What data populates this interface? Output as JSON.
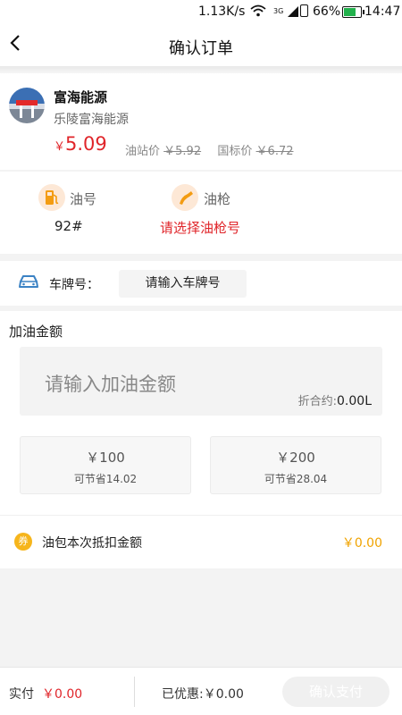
{
  "status_bar": {
    "speed": "1.13K/s",
    "network": "3G",
    "battery": "66%",
    "battery_level": 0.66,
    "time": "14:47"
  },
  "header": {
    "back_icon": "chevron-left-icon",
    "title": "确认订单"
  },
  "station": {
    "name": "富海能源",
    "subname": "乐陵富海能源",
    "price_currency": "￥",
    "price": "5.09",
    "station_price_label": "油站价",
    "station_price": "￥5.92",
    "national_price_label": "国标价",
    "national_price": "￥6.72"
  },
  "fuel": {
    "grade_label": "油号",
    "grade_value": "92#",
    "nozzle_label": "油枪",
    "nozzle_value": "请选择油枪号",
    "nozzle_color": "#e0252a"
  },
  "plate": {
    "label": "车牌号：",
    "placeholder": "请输入车牌号"
  },
  "amount": {
    "title": "加油金额",
    "placeholder": "请输入加油金额",
    "conversion_label": "折合约:",
    "conversion_value": "0.00L",
    "presets": [
      {
        "amount": "￥100",
        "saving": "可节省14.02"
      },
      {
        "amount": "￥200",
        "saving": "可节省28.04"
      }
    ],
    "coupon_icon_text": "券",
    "coupon_label": "油包本次抵扣金额",
    "coupon_value": "￥0.00"
  },
  "footer": {
    "paid_label": "实付",
    "paid_value": "￥0.00",
    "discount": "已优惠:￥0.00",
    "pay_button": "确认支付"
  },
  "colors": {
    "accent_red": "#e0252a",
    "coupon_yellow": "#f0a300",
    "icon_orange": "#f39c12"
  }
}
